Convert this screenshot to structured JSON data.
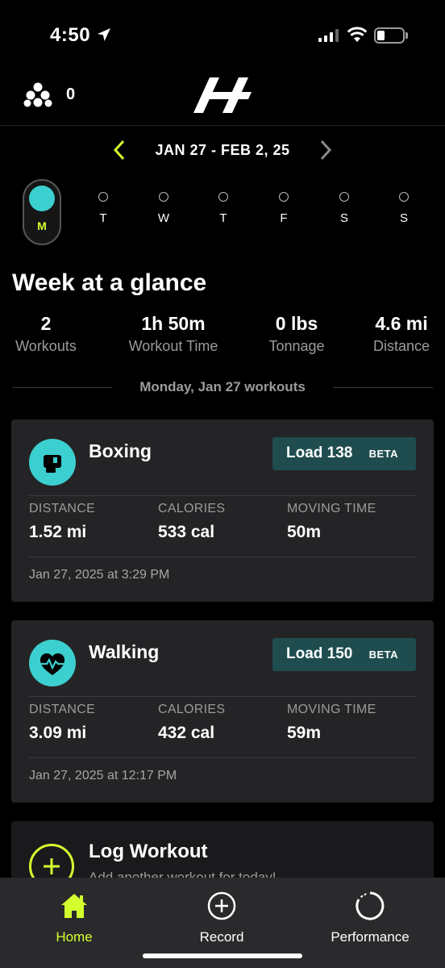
{
  "status_bar": {
    "time": "4:50"
  },
  "header": {
    "points": "0"
  },
  "week_nav": {
    "range": "JAN 27 - FEB 2, 25"
  },
  "days": [
    {
      "label": "M",
      "selected": true
    },
    {
      "label": "T"
    },
    {
      "label": "W"
    },
    {
      "label": "T"
    },
    {
      "label": "F"
    },
    {
      "label": "S"
    },
    {
      "label": "S"
    }
  ],
  "glance": {
    "title": "Week at a glance",
    "stats": [
      {
        "value": "2",
        "label": "Workouts"
      },
      {
        "value": "1h 50m",
        "label": "Workout Time"
      },
      {
        "value": "0 lbs",
        "label": "Tonnage"
      },
      {
        "value": "4.6 mi",
        "label": "Distance"
      }
    ]
  },
  "section_label": "Monday, Jan 27 workouts",
  "workouts": [
    {
      "title": "Boxing",
      "icon": "boxing-glove-icon",
      "load": "Load 138",
      "badge": "BETA",
      "metrics": [
        {
          "label": "DISTANCE",
          "value": "1.52 mi"
        },
        {
          "label": "CALORIES",
          "value": "533 cal"
        },
        {
          "label": "MOVING TIME",
          "value": "50m"
        }
      ],
      "date": "Jan 27, 2025 at 3:29 PM"
    },
    {
      "title": "Walking",
      "icon": "heart-pulse-icon",
      "load": "Load 150",
      "badge": "BETA",
      "metrics": [
        {
          "label": "DISTANCE",
          "value": "3.09 mi"
        },
        {
          "label": "CALORIES",
          "value": "432 cal"
        },
        {
          "label": "MOVING TIME",
          "value": "59m"
        }
      ],
      "date": "Jan 27, 2025 at 12:17 PM"
    }
  ],
  "log_workout": {
    "title": "Log Workout",
    "subtitle": "Add another workout for today!"
  },
  "tabs": [
    {
      "label": "Home",
      "icon": "home-icon",
      "active": true
    },
    {
      "label": "Record",
      "icon": "plus-circle-icon"
    },
    {
      "label": "Performance",
      "icon": "progress-ring-icon"
    }
  ],
  "colors": {
    "accent": "#d4ff2e",
    "teal": "#3ccfcf",
    "badge_bg": "#1f4d4f",
    "card_bg": "#242426"
  }
}
